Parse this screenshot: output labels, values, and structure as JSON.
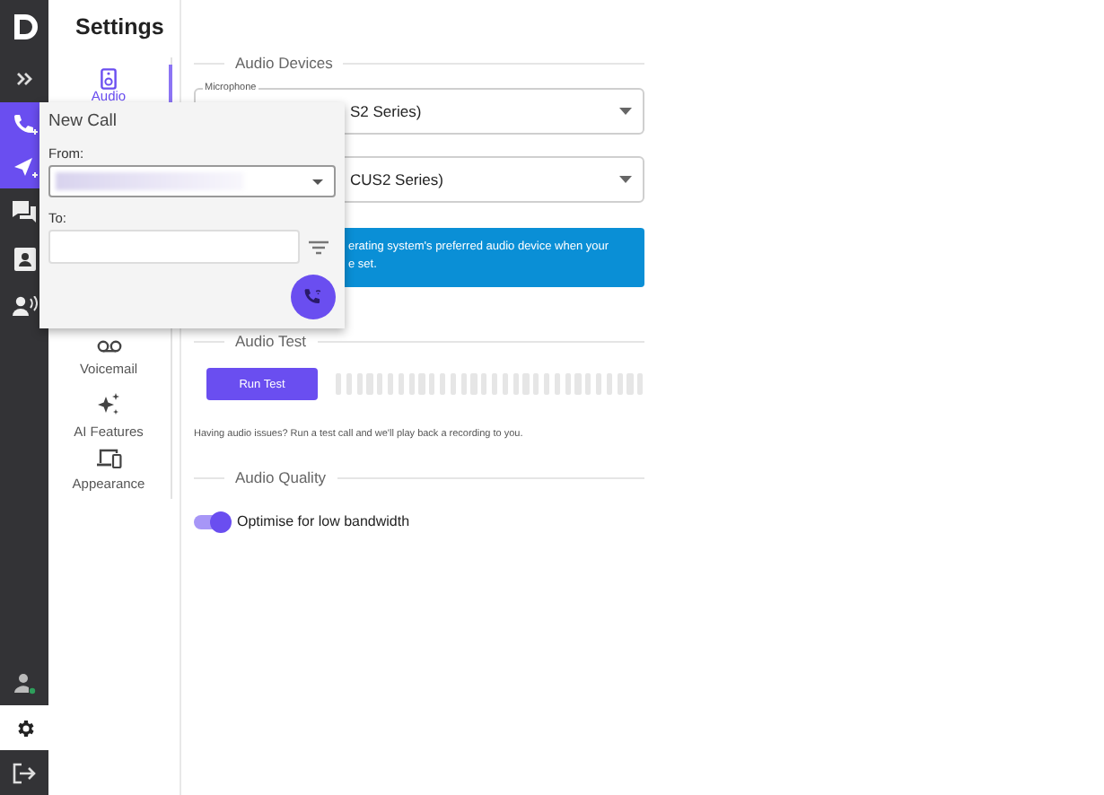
{
  "rail": {
    "top": [
      {
        "kind": "logo",
        "selected": false
      },
      {
        "kind": "expand",
        "selected": false
      },
      {
        "kind": "call",
        "selected": true
      },
      {
        "kind": "message",
        "selected": true
      },
      {
        "kind": "chat",
        "selected": false
      },
      {
        "kind": "contacts",
        "selected": false
      },
      {
        "kind": "voice",
        "selected": false
      }
    ],
    "bottom": [
      {
        "kind": "status",
        "selected": false
      },
      {
        "kind": "settings",
        "selected": true
      },
      {
        "kind": "logout",
        "selected": false
      }
    ]
  },
  "settings": {
    "title": "Settings",
    "items": [
      {
        "kind": "audio",
        "label": "Audio",
        "selected": true
      },
      {
        "kind": "voicemail",
        "label": "Voicemail",
        "selected": false
      },
      {
        "kind": "ai",
        "label": "AI Features",
        "selected": false
      },
      {
        "kind": "appearance",
        "label": "Appearance",
        "selected": false
      }
    ]
  },
  "audio_devices": {
    "heading": "Audio Devices",
    "microphone": {
      "label": "Microphone",
      "value": "S2 Series)"
    },
    "speaker": {
      "value": "CUS2 Series)"
    },
    "banner": "erating system's preferred audio device when your e set."
  },
  "audio_test": {
    "heading": "Audio Test",
    "button": "Run Test",
    "help": "Having audio issues? Run a test call and we'll play back a recording to you."
  },
  "audio_quality": {
    "heading": "Audio Quality",
    "toggle": {
      "label": "Optimise for low bandwidth",
      "on": true
    }
  },
  "new_call": {
    "title": "New Call",
    "from_label": "From:",
    "to_label": "To:"
  }
}
